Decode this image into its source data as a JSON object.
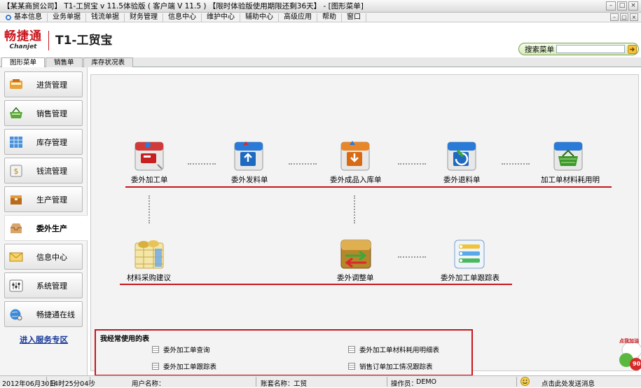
{
  "window": {
    "title": "【某某商贸公司】 T1-工贸宝 v 11.5体验版 ( 客户端 V 11.5 ) 【限时体验版使用期限还剩36天】 - [图形菜单]"
  },
  "menu": [
    "基本信息",
    "业务单据",
    "钱流单据",
    "财务管理",
    "信息中心",
    "维护中心",
    "辅助中心",
    "高级应用",
    "帮助",
    "窗口"
  ],
  "brand": {
    "name_cn": "畅捷通",
    "name_en": "Chanjet",
    "product": "T1-工贸宝",
    "accent": "#c8161d"
  },
  "search": {
    "label": "搜索菜单",
    "value": ""
  },
  "tabs": [
    "图形菜单",
    "销售单",
    "库存状况表"
  ],
  "sidebar": {
    "items": [
      {
        "label": "进货管理",
        "icon": "purchase-cart-icon"
      },
      {
        "label": "销售管理",
        "icon": "sales-basket-icon"
      },
      {
        "label": "库存管理",
        "icon": "inventory-grid-icon"
      },
      {
        "label": "钱流管理",
        "icon": "cashflow-icon"
      },
      {
        "label": "生产管理",
        "icon": "production-box-icon"
      },
      {
        "label": "委外生产",
        "icon": "outsource-inbox-icon"
      },
      {
        "label": "信息中心",
        "icon": "info-envelope-icon"
      },
      {
        "label": "系统管理",
        "icon": "system-settings-icon"
      },
      {
        "label": "畅捷通在线",
        "icon": "online-globe-icon"
      }
    ],
    "active_index": 5,
    "service_link": "进入服务专区"
  },
  "flow": {
    "row1": [
      "委外加工单",
      "委外发料单",
      "委外成品入库单",
      "委外退料单",
      "加工单材料耗用明"
    ],
    "row2": [
      "材料采购建议",
      "委外调整单",
      "委外加工单跟踪表"
    ]
  },
  "frequent": {
    "title": "我经常使用的表",
    "items": [
      "委外加工单查询",
      "委外加工单材料耗用明细表",
      "委外加工单跟踪表",
      "销售订单加工情况跟踪表"
    ]
  },
  "status": {
    "date": "2012年06月30日",
    "time": "14时25分04秒",
    "user_label": "用户名称：",
    "user_value": "",
    "account_label": "账套名称：",
    "account_value": "工贸",
    "operator_label": "操作员：",
    "operator_value": "DEMO",
    "message": "点击此处发送消息"
  },
  "promo": {
    "badge": "点我加油",
    "count": "90"
  }
}
